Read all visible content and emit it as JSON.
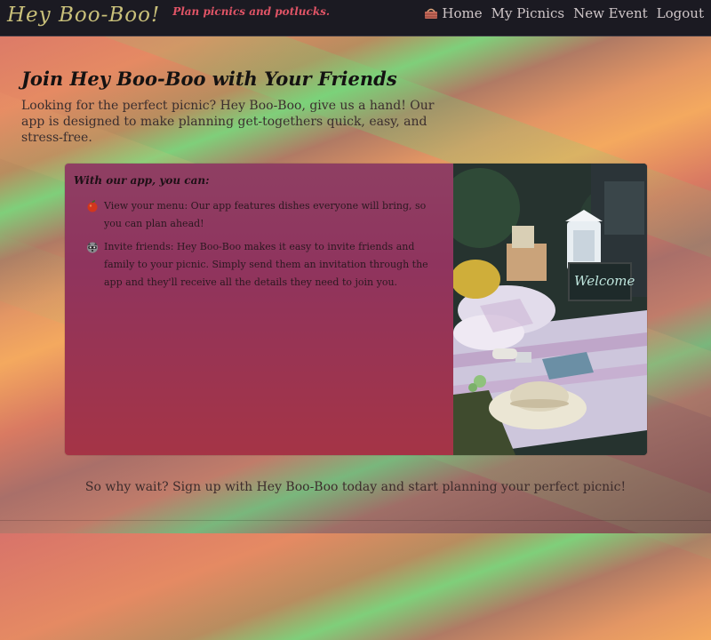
{
  "brand": {
    "logo_text": "Hey Boo-Boo!",
    "tagline": "Plan picnics and potlucks."
  },
  "nav": {
    "home_icon": "picnic-basket-icon",
    "items": [
      "Home",
      "My Picnics",
      "New Event",
      "Logout"
    ]
  },
  "hero": {
    "title": "Join Hey Boo-Boo with Your Friends",
    "description": "Looking for the perfect picnic? Hey Boo-Boo, give us a hand! Our app is designed to make planning get-togethers quick, easy, and stress-free."
  },
  "features": {
    "heading": "With our app, you can:",
    "items": [
      {
        "icon": "apple-icon",
        "text": "View your menu: Our app features dishes everyone will bring, so you can plan ahead!"
      },
      {
        "icon": "raccoon-icon",
        "text": "Invite friends: Hey Boo-Boo makes it easy to invite friends and family to your picnic. Simply send them an invitation through the app and they'll receive all the details they need to join you."
      }
    ]
  },
  "photo": {
    "sign_text": "Welcome"
  },
  "cta": {
    "text": "So why wait? Sign up with Hey Boo-Boo today and start planning your perfect picnic!"
  },
  "colors": {
    "navbar_bg": "#1b1a22",
    "brand_color": "#c9c07a",
    "tagline_color": "#e05466",
    "nav_link_color": "#cfc6c8"
  }
}
